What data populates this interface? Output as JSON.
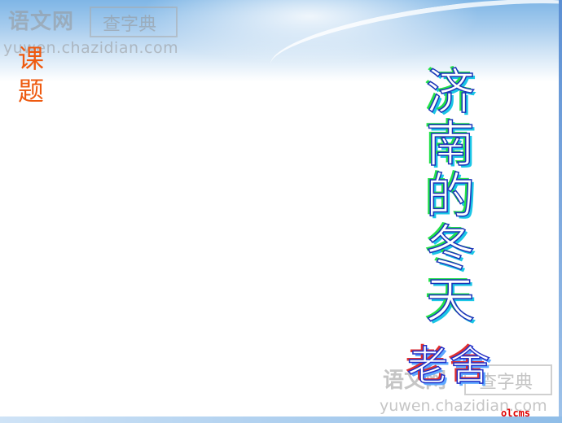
{
  "watermark": {
    "site_name_top": "语文网",
    "dict_name_top": "查字典",
    "url_top": "yuwen.chazidian.com",
    "site_name_bottom": "语文网",
    "dict_name_bottom": "查字典",
    "url_bottom": "yuwen.chazidian.com"
  },
  "slide": {
    "lesson_label_chars": [
      "课",
      "题"
    ],
    "title_chars": [
      "济",
      "南",
      "的",
      "冬",
      "天"
    ],
    "author": "老舍",
    "footer_tag": "olcms"
  },
  "colors": {
    "lesson_label": "#ee5a10",
    "title_stroke": "#1a35b8",
    "title_shadow_green": "#22e04a",
    "title_shadow_cyan": "#1ac6e6",
    "author_stroke": "#2230c8",
    "author_shadow_red": "#e03030",
    "footer_tag": "#e00000",
    "header_sky": "#7fb6e6"
  }
}
